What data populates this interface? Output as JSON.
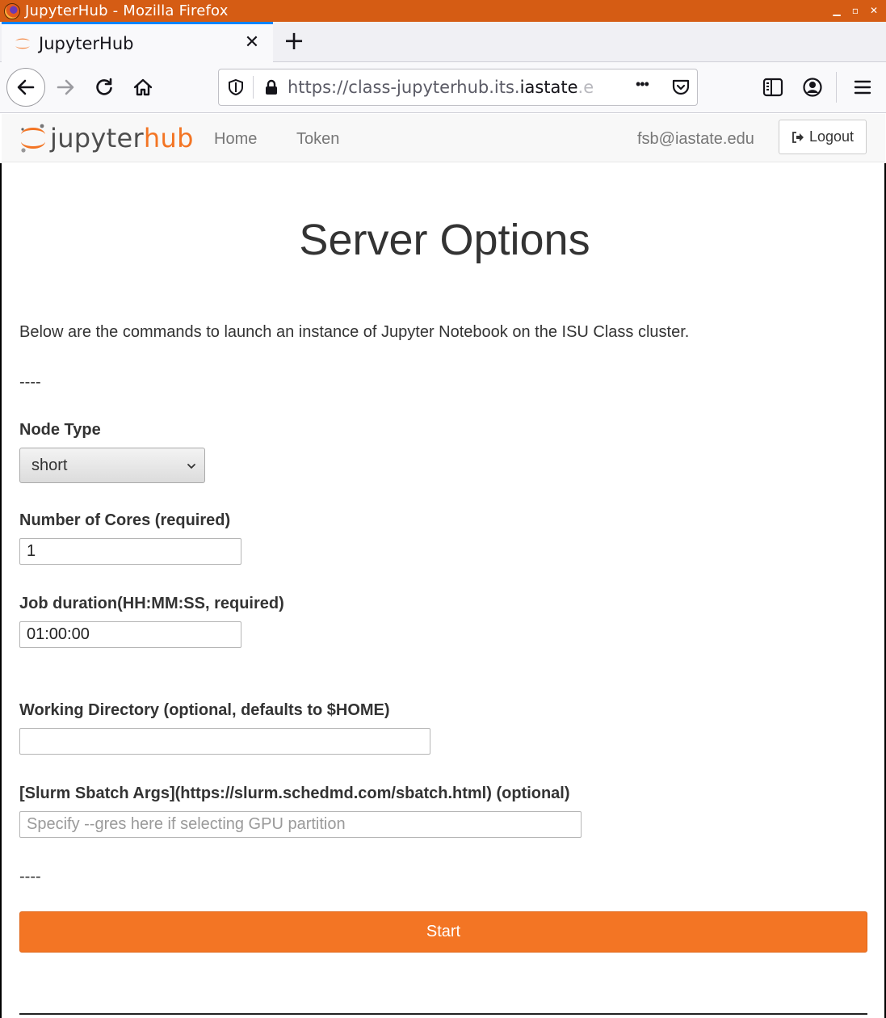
{
  "window": {
    "title": "JupyterHub - Mozilla Firefox",
    "controls": [
      "minimize",
      "maximize",
      "close"
    ]
  },
  "browser": {
    "tab_title": "JupyterHub",
    "url_prefix": "https://class-jupyterhub.its.",
    "url_host": "iastate",
    "url_fade": ".e",
    "menu_dots": "•••"
  },
  "header": {
    "logo_part1": "jupyter",
    "logo_part2": "hub",
    "nav_home": "Home",
    "nav_token": "Token",
    "user": "fsb@iastate.edu",
    "logout_label": "Logout"
  },
  "main": {
    "title": "Server Options",
    "intro": "Below are the commands to launch an instance of Jupyter Notebook on the ISU Class cluster.",
    "separator": "----",
    "node_type_label": "Node Type",
    "node_type_value": "short",
    "cores_label": "Number of Cores (required)",
    "cores_value": "1",
    "duration_label": "Job duration(HH:MM:SS, required)",
    "duration_value": "01:00:00",
    "workdir_label": "Working Directory (optional, defaults to $HOME)",
    "workdir_value": "",
    "sbatch_label": "[Slurm Sbatch Args](https://slurm.schedmd.com/sbatch.html) (optional)",
    "sbatch_placeholder": "Specify --gres here if selecting GPU partition",
    "start_label": "Start"
  },
  "colors": {
    "accent": "#f37524",
    "os_titlebar": "#d55c14"
  }
}
